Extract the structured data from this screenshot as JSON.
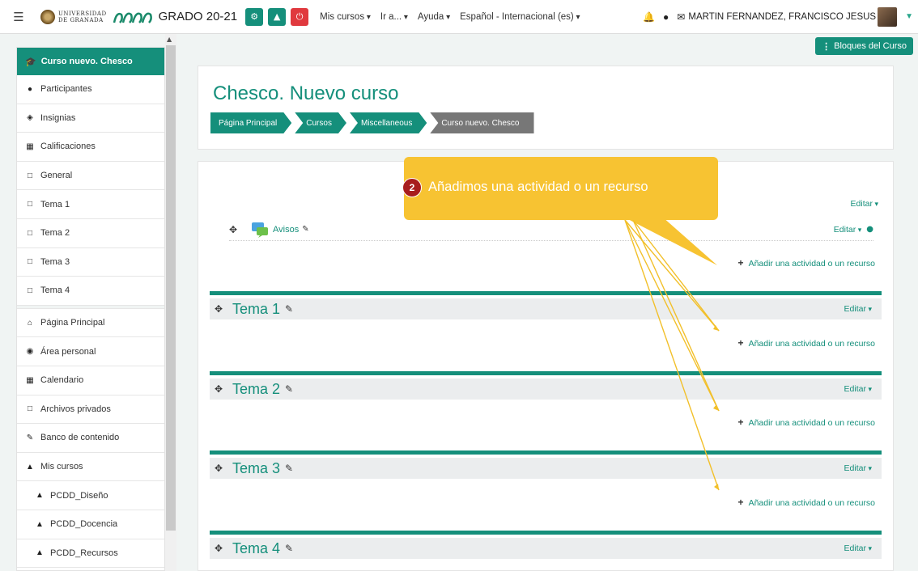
{
  "navbar": {
    "menu_icon": "hamburger-icon",
    "university_line1": "UNIVERSIDAD",
    "university_line2": "DE GRANADA",
    "site_name": "GRADO 20-21",
    "buttons": [
      {
        "icon": "settings-icon",
        "color": "#158f7b"
      },
      {
        "icon": "sitemap-icon",
        "color": "#158f7b"
      },
      {
        "icon": "power-icon",
        "color": "#e0393e"
      }
    ],
    "menu": [
      "Mis cursos",
      "Ir a...",
      "Ayuda",
      "Español - Internacional (es)"
    ],
    "user_name": "MARTIN FERNANDEZ, FRANCISCO JESUS"
  },
  "sidebar": {
    "course": "Curso nuevo. Chesco",
    "items": [
      {
        "label": "Participantes",
        "icon": "users-icon"
      },
      {
        "label": "Insignias",
        "icon": "shield-icon"
      },
      {
        "label": "Calificaciones",
        "icon": "table-icon"
      },
      {
        "label": "General",
        "icon": "folder-icon"
      },
      {
        "label": "Tema 1",
        "icon": "folder-icon"
      },
      {
        "label": "Tema 2",
        "icon": "folder-icon"
      },
      {
        "label": "Tema 3",
        "icon": "folder-icon"
      },
      {
        "label": "Tema 4",
        "icon": "folder-icon"
      }
    ],
    "items2": [
      {
        "label": "Página Principal",
        "icon": "home-icon"
      },
      {
        "label": "Área personal",
        "icon": "dashboard-icon"
      },
      {
        "label": "Calendario",
        "icon": "calendar-icon"
      },
      {
        "label": "Archivos privados",
        "icon": "file-icon"
      },
      {
        "label": "Banco de contenido",
        "icon": "brush-icon"
      },
      {
        "label": "Mis cursos",
        "icon": "graduation-cap-icon"
      },
      {
        "label": "PCDD_Diseño",
        "icon": "graduation-cap-icon"
      },
      {
        "label": "PCDD_Docencia",
        "icon": "graduation-cap-icon"
      },
      {
        "label": "PCDD_Recursos",
        "icon": "graduation-cap-icon"
      }
    ]
  },
  "bloques_label": "Bloques del Curso",
  "header": {
    "title": "Chesco. Nuevo curso",
    "breadcrumb": [
      "Página Principal",
      "Cursos",
      "Miscellaneous",
      "Curso nuevo. Chesco"
    ]
  },
  "main": {
    "editar": "Editar",
    "avisos": "Avisos",
    "add_activity": "Añadir una actividad o un recurso",
    "sections": [
      "Tema 1",
      "Tema 2",
      "Tema 3",
      "Tema 4"
    ]
  },
  "callout": {
    "number": "2",
    "text": "Añadimos una actividad o un recurso",
    "color": "#f7c332",
    "badge_color": "#a81d1d"
  },
  "colors": {
    "accent": "#158f7b",
    "breadcrumb_last": "#777777"
  }
}
